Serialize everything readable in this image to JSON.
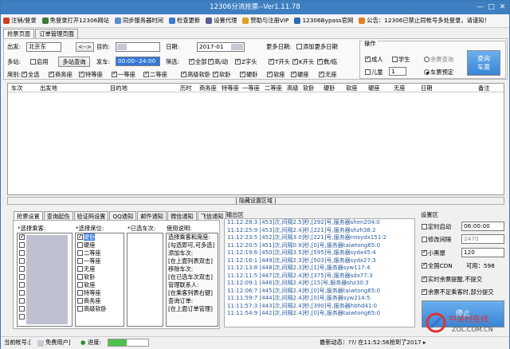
{
  "window": {
    "title": "12306分流抢票--Ver1.11.78",
    "min": "—",
    "max": "□",
    "close": "✕"
  },
  "toolbar": [
    {
      "label": "注销/登录",
      "color": "#d04020"
    },
    {
      "label": "免登录打开12306网站",
      "color": "#3a7a3a"
    },
    {
      "label": "同步服务器时间",
      "color": "#5a8cc8"
    },
    {
      "label": "检查更新",
      "color": "#3a7ad0"
    },
    {
      "label": "设置代理",
      "color": "#5a5a9a"
    },
    {
      "label": "赞助与注册VIP",
      "color": "#e0a020"
    },
    {
      "label": "12306Bypass官网",
      "color": "#2a6ab0"
    },
    {
      "label": "公告：12306已禁止同帐号多处登录，请谨知！",
      "color": "#e08020"
    }
  ],
  "tabs": [
    "抢票页面",
    "订单管理页面"
  ],
  "form": {
    "from_label": "出发:",
    "from_value": "北京东",
    "swap_label": "<-->",
    "to_label": "目的:",
    "date_label": "日期:",
    "date_value": "2017-01",
    "more_dates_label": "更多日期:",
    "add_dates_label": "添加更多日期",
    "multi_station_label": "多站:",
    "enable_label": "启用",
    "multi_query_button": "多站查询",
    "depart_time_label": "发车:",
    "depart_time_value": "00:00--24:00",
    "filter_label": "筛选:",
    "filters": [
      {
        "label": "全部",
        "on": true
      },
      {
        "label": "高/动",
        "on": true
      },
      {
        "label": "Z字头",
        "on": true
      },
      {
        "label": "T开头",
        "on": true
      },
      {
        "label": "K开头",
        "on": true
      },
      {
        "label": "数/临",
        "on": true
      }
    ],
    "seat_label": "席别:",
    "seats": [
      {
        "label": "全选",
        "on": true
      },
      {
        "label": "商务座",
        "on": true
      },
      {
        "label": "特等座",
        "on": true
      },
      {
        "label": "一等座",
        "on": true
      },
      {
        "label": "二等座",
        "on": true
      },
      {
        "label": "高级软卧",
        "on": true
      },
      {
        "label": "软卧",
        "on": true
      },
      {
        "label": "硬卧",
        "on": true
      },
      {
        "label": "软座",
        "on": true
      },
      {
        "label": "硬座",
        "on": true
      },
      {
        "label": "无座",
        "on": true
      }
    ]
  },
  "operation": {
    "group_label": "操作",
    "adult_label": "成人",
    "student_label": "学生",
    "child_label": "儿童",
    "child_count": "1",
    "remaining_query_label": "余票查询",
    "reserve_label": "车票预定",
    "query_button": "查询\n车票"
  },
  "grid": {
    "columns": [
      "车次",
      "出发地",
      "目的地",
      "历时",
      "商务座",
      "特等座",
      "一等座",
      "二等座",
      "高级",
      "软卧",
      "硬卧",
      "软座",
      "硬座",
      "无座",
      "日期",
      "备注"
    ]
  },
  "hide_bar_label": "| 隐藏设置区域 |",
  "bottom_tabs": [
    "抢票设置",
    "查询起伤",
    "验证码设置",
    "QQ通知",
    "邮件通知",
    "微信通知",
    "飞信通知"
  ],
  "settings": {
    "passenger_label": "*选择乘客:",
    "seat_pick_label": "*选择席位:",
    "selected_trains_label": "*已选车次:",
    "usage_label": "使用说明:",
    "seat_options": [
      "硬卧",
      "硬座",
      "二等座",
      "一等座",
      "无座",
      "软卧",
      "软座",
      "特等座",
      "商务座",
      "高级软卧"
    ],
    "usage_lines": [
      "选择乘客和席座:",
      "[勾选即可,可多选]",
      "添加车次:",
      "[在上面列表双击]",
      "移除车次:",
      "[在已选车次双击]",
      "管理联系人:",
      "[在乘客列表右键]",
      "查询订单:",
      "[在上面订单管理]"
    ]
  },
  "log": {
    "label": "输出区",
    "lines": [
      "11:12:28:3 [453]次,间隔2.5]秒,[292]号,服务器shen204:0",
      "11:12:25:9 [453]次,间隔2.4]秒,[221]号,服务器shzh38:2",
      "11:12:23:5 [452]次,间隔3.0]秒,[221]号,服务器nnsydx151:2",
      "11:12:20:5 [451]次,间隔0.9]秒,[0]号,服务器taiwtong65:0",
      "11:12:19:6 [450]次,间隔3.5]秒,[595]号,服务器sydx45:4",
      "11:12:16:1 [449]次,间隔2.3]秒,[503]号,服务器sydx27:3",
      "11:12:13:8 [448]次,间隔2.3]秒,[1]号,服务器syw117:4",
      "11:12:11:5 [447]次,间隔2.4]秒,[375]号,服务器sdx77:3",
      "11:12:09:1 [446]次,间隔2.4]秒,[15]号,服务器shz30:3",
      "11:12:06:7 [445]次,间隔2.4]秒,[0]号,服务器taiwtong65:0",
      "11:11:59:7 [444]次,间隔2.4]秒,[0]号,服务器syw214:5",
      "11:11:57:3 [443]次,间隔2.4]秒,[390]号,服务器hbhd41:0",
      "11:11:54:9 [442]次,间隔2.4]秒,[0]号,服务器taiwtong65:0"
    ]
  },
  "right_settings": {
    "label": "设置区",
    "timed_start_label": "定时启动",
    "timed_start_value": "06:00:00",
    "modify_interval_label": "修改间隔",
    "modify_interval_value": "2470",
    "blacklist_label": "小黑屋",
    "blacklist_value": "120",
    "cdn_label": "全国CDN",
    "cdn_value": "可用：598",
    "realtime_label": "实时余票提醒,不提交",
    "insufficient_label": "余票不足乘客时,部分提交",
    "start_button": "停止"
  },
  "status": {
    "account": "当前帐号:[",
    "user": "免费用户]",
    "progress_label": "进度:",
    "progress_value": 0.45,
    "latest": "最新动态：??/ 在11:52:56抢到了2017 ▸"
  },
  "watermark": {
    "title": "中关村在线",
    "url": "ZOL.COM.CN"
  }
}
